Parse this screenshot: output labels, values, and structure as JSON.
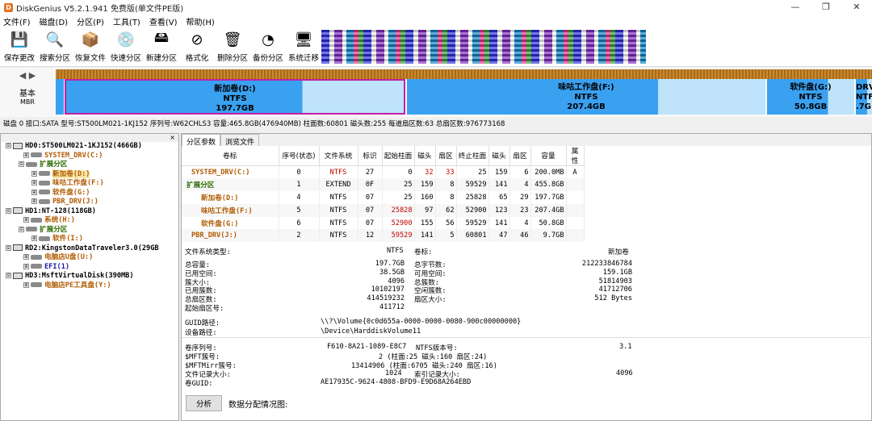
{
  "app": {
    "title": "DiskGenius V5.2.1.941 免费版(单文件PE版)",
    "icon_text": "D"
  },
  "window": {
    "minimize": "—",
    "restore": "❐",
    "close": "✕"
  },
  "menu": [
    "文件(F)",
    "磁盘(D)",
    "分区(P)",
    "工具(T)",
    "查看(V)",
    "帮助(H)"
  ],
  "toolbar": [
    {
      "label": "保存更改",
      "icon": "save-icon",
      "glyph": "💾"
    },
    {
      "label": "搜索分区",
      "icon": "search-icon",
      "glyph": "🔍"
    },
    {
      "label": "恢复文件",
      "icon": "recover-icon",
      "glyph": "📦"
    },
    {
      "label": "快速分区",
      "icon": "quick-partition-icon",
      "glyph": "💿"
    },
    {
      "label": "新建分区",
      "icon": "new-partition-icon",
      "glyph": "🖴"
    },
    {
      "label": "格式化",
      "icon": "format-icon",
      "glyph": "⊘"
    },
    {
      "label": "删除分区",
      "icon": "delete-icon",
      "glyph": "🗑"
    },
    {
      "label": "备份分区",
      "icon": "backup-icon",
      "glyph": "◔"
    },
    {
      "label": "系统迁移",
      "icon": "migrate-icon",
      "glyph": "🖥"
    }
  ],
  "diskmap": {
    "nav_arrows": "◀ ▶",
    "basic": "基本",
    "mbr": "MBR",
    "partitions": [
      {
        "name": "新加卷(D:)",
        "fs": "NTFS",
        "size": "197.7GB"
      },
      {
        "name": "味咕工作盘(F:)",
        "fs": "NTFS",
        "size": "207.4GB"
      },
      {
        "name": "软件盘(G:)",
        "fs": "NTFS",
        "size": "50.8GB"
      },
      {
        "name": "DRV",
        "fs": "NTFS",
        "size": ".7G"
      }
    ]
  },
  "diskinfo": "磁盘 0 接口:SATA  型号:ST500LM021-1KJ152  序列号:W62CHLS3  容量:465.8GB(476940MB)  柱面数:60801  磁头数:255  每道扇区数:63  总扇区数:976773168",
  "tree": {
    "close": "×",
    "nodes": [
      {
        "ex": "⊟",
        "type": "disk",
        "text": "HD0:ST500LM021-1KJ152(466GB)",
        "cls": ""
      },
      {
        "ex": "⊞",
        "type": "part",
        "text": "SYSTEM_DRV(C:)",
        "cls": "orange"
      },
      {
        "ex": "⊟",
        "type": "ext",
        "text": "扩展分区",
        "cls": "green"
      },
      {
        "ex": "⊞",
        "type": "part",
        "text": "新加卷(D:)",
        "cls": "orange",
        "hl": true
      },
      {
        "ex": "⊞",
        "type": "part",
        "text": "味咕工作盘(F:)",
        "cls": "orange"
      },
      {
        "ex": "⊞",
        "type": "part",
        "text": "软件盘(G:)",
        "cls": "orange"
      },
      {
        "ex": "⊞",
        "type": "part",
        "text": "PBR_DRV(J:)",
        "cls": "orange"
      },
      {
        "ex": "⊟",
        "type": "disk",
        "text": "HD1:NT-128(118GB)",
        "cls": ""
      },
      {
        "ex": "⊞",
        "type": "part",
        "text": "系统(H:)",
        "cls": "orange"
      },
      {
        "ex": "⊟",
        "type": "ext",
        "text": "扩展分区",
        "cls": "green"
      },
      {
        "ex": "⊞",
        "type": "part",
        "text": "软件(I:)",
        "cls": "orange"
      },
      {
        "ex": "⊟",
        "type": "disk",
        "text": "RD2:KingstonDataTraveler3.0(29GB",
        "cls": ""
      },
      {
        "ex": "⊞",
        "type": "part",
        "text": "电脑店U盘(U:)",
        "cls": "orange"
      },
      {
        "ex": "⊞",
        "type": "part",
        "text": "EFI(1)",
        "cls": "blue"
      },
      {
        "ex": "⊟",
        "type": "disk",
        "text": "HD3:MsftVirtualDisk(390MB)",
        "cls": ""
      },
      {
        "ex": "⊞",
        "type": "part",
        "text": "电脑店PE工具盘(Y:)",
        "cls": "orange"
      }
    ]
  },
  "tabs": [
    "分区参数",
    "浏览文件"
  ],
  "table": {
    "headers": [
      "卷标",
      "序号(状态)",
      "文件系统",
      "标识",
      "起始柱面",
      "磁头",
      "扇区",
      "终止柱面",
      "磁头",
      "扇区",
      "容量",
      "属性"
    ],
    "rows": [
      {
        "name": "SYSTEM_DRV(C:)",
        "cls": "orange",
        "cells": [
          "0",
          "NTFS",
          "27",
          "0",
          "32",
          "33",
          "25",
          "159",
          "6",
          "200.0MB",
          "A"
        ],
        "fsred": true
      },
      {
        "name": "扩展分区",
        "cls": "green",
        "cells": [
          "1",
          "EXTEND",
          "0F",
          "25",
          "159",
          "8",
          "59529",
          "141",
          "4",
          "455.8GB",
          ""
        ],
        "fsred": false
      },
      {
        "name": "新加卷(D:)",
        "cls": "orange",
        "cells": [
          "4",
          "NTFS",
          "07",
          "25",
          "160",
          "8",
          "25828",
          "65",
          "29",
          "197.7GB",
          ""
        ],
        "fsred": false
      },
      {
        "name": "味咕工作盘(F:)",
        "cls": "orange",
        "cells": [
          "5",
          "NTFS",
          "07",
          "25828",
          "97",
          "62",
          "52900",
          "123",
          "23",
          "207.4GB",
          ""
        ],
        "fsred": false
      },
      {
        "name": "软件盘(G:)",
        "cls": "orange",
        "cells": [
          "6",
          "NTFS",
          "07",
          "52900",
          "155",
          "56",
          "59529",
          "141",
          "4",
          "50.8GB",
          ""
        ],
        "fsred": false
      },
      {
        "name": "PBR_DRV(J:)",
        "cls": "orange",
        "cells": [
          "2",
          "NTFS",
          "12",
          "59529",
          "141",
          "5",
          "60801",
          "47",
          "46",
          "9.7GB",
          ""
        ],
        "fsred": false
      }
    ]
  },
  "details": {
    "fstype_label": "文件系统类型:",
    "fstype": "NTFS",
    "vol_label": "卷标:",
    "vol": "新加卷",
    "left": [
      [
        "总容量:",
        "197.7GB"
      ],
      [
        "已用空间:",
        "38.5GB"
      ],
      [
        "簇大小:",
        "4096"
      ],
      [
        "已用簇数:",
        "10102197"
      ],
      [
        "总扇区数:",
        "414519232"
      ],
      [
        "起始扇区号:",
        "411712"
      ]
    ],
    "right": [
      [
        "总字节数:",
        "212233846784"
      ],
      [
        "可用空间:",
        "159.1GB"
      ],
      [
        "总簇数:",
        "51814903"
      ],
      [
        "空闲簇数:",
        "41712706"
      ],
      [
        "扇区大小:",
        "512 Bytes"
      ]
    ],
    "guid_label": "GUID路径:",
    "guid": "\\\\?\\Volume{0c0d655a-0000-0000-0080-900c00000000}",
    "dev_label": "设备路径:",
    "dev": "\\Device\\HarddiskVolume11",
    "serial_label": "卷序列号:",
    "serial": "F610-8A21-1089-E8C7",
    "ntfsver_label": "NTFS版本号:",
    "ntfsver": "3.1",
    "mft_label": "$MFT簇号:",
    "mft": "2 (柱面:25 磁头:160 扇区:24)",
    "mftmirr_label": "$MFTMirr簇号:",
    "mftmirr": "13414906 (柱面:6705 磁头:240 扇区:16)",
    "filerec_label": "文件记录大小:",
    "filerec": "1024",
    "idxrec_label": "索引记录大小:",
    "idxrec": "4096",
    "volguid_label": "卷GUID:",
    "volguid": "AE17935C-9624-4808-BFD9-E9D68A264EBD"
  },
  "bottom": {
    "analyze": "分析",
    "alloc_label": "数据分配情况图:"
  }
}
